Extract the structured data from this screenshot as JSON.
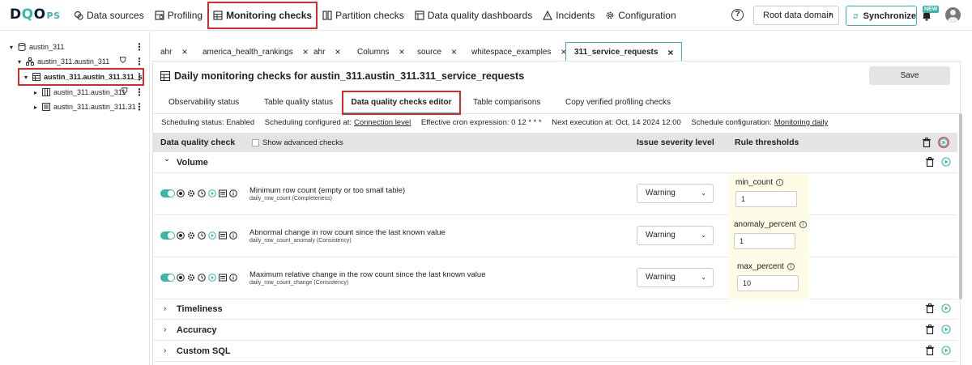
{
  "app": {
    "logo_main": "D",
    "logo_q": "Q",
    "logo_o": "O",
    "logo_ps": "PS"
  },
  "nav": [
    {
      "label": "Data sources",
      "icon": "data-sources-icon"
    },
    {
      "label": "Profiling",
      "icon": "profiling-icon"
    },
    {
      "label": "Monitoring checks",
      "icon": "monitoring-table-icon",
      "active": true
    },
    {
      "label": "Partition checks",
      "icon": "partition-icon"
    },
    {
      "label": "Data quality dashboards",
      "icon": "dashboards-icon"
    },
    {
      "label": "Incidents",
      "icon": "incidents-icon"
    },
    {
      "label": "Configuration",
      "icon": "gear-icon"
    }
  ],
  "header": {
    "help": "?",
    "root_domain": "Root data domain",
    "root_domain_chevron": "›",
    "sync": "Synchronize",
    "new_badge": "NEW"
  },
  "tree": [
    {
      "label": "austin_311",
      "toggle": "▾",
      "icon": "database-icon"
    },
    {
      "label": "austin_311.austin_311",
      "toggle": "▾",
      "icon": "schema-icon"
    },
    {
      "label": "austin_311.austin_311.311_s",
      "toggle": "▾",
      "icon": "table-icon",
      "selected": true
    },
    {
      "label": "austin_311.austin_311",
      "toggle": "▸",
      "icon": "columns-icon"
    },
    {
      "label": "austin_311.austin_311.31",
      "toggle": "▸",
      "icon": "checks-icon"
    }
  ],
  "editor_tabs": [
    {
      "label": "ahr",
      "close": "×"
    },
    {
      "label": "america_health_rankings",
      "close": "×"
    },
    {
      "label": "ahr",
      "close": "×"
    },
    {
      "label": "Columns",
      "close": "×"
    },
    {
      "label": "source",
      "close": "×"
    },
    {
      "label": "whitespace_examples",
      "close": "×"
    },
    {
      "label": "311_service_requests",
      "close": "×",
      "active": true
    }
  ],
  "page": {
    "title": "Daily monitoring checks for austin_311.austin_311.311_service_requests",
    "save": "Save"
  },
  "sub_tabs": [
    {
      "label": "Observability status"
    },
    {
      "label": "Table quality status"
    },
    {
      "label": "Data quality checks editor",
      "active": true
    },
    {
      "label": "Table comparisons"
    },
    {
      "label": "Copy verified profiling checks"
    }
  ],
  "schedule": {
    "status_label": "Scheduling status: Enabled",
    "configured_label": "Scheduling configured at:",
    "configured_link": "Connection level",
    "cron_label": "Effective cron expression: 0 12 * * *",
    "next_label": "Next execution at: Oct, 14 2024 12:00",
    "config_label": "Schedule configuration:",
    "config_link": "Monitoring daily"
  },
  "grid": {
    "col_check": "Data quality check",
    "advanced": "Show advanced checks",
    "col_severity": "Issue severity level",
    "col_thresholds": "Rule thresholds"
  },
  "categories": {
    "volume": {
      "name": "Volume",
      "chevron": "⌄"
    },
    "timeliness": {
      "name": "Timeliness",
      "chevron": "›"
    },
    "accuracy": {
      "name": "Accuracy",
      "chevron": "›"
    },
    "custom_sql": {
      "name": "Custom SQL",
      "chevron": "›"
    }
  },
  "checks": [
    {
      "name": "Minimum row count (empty or too small table)",
      "sub": "daily_row_count (Completeness)",
      "severity": "Warning",
      "threshold_label": "min_count",
      "threshold_value": "1"
    },
    {
      "name": "Abnormal change in row count since the last known value",
      "sub": "daily_row_count_anomaly (Consistency)",
      "severity": "Warning",
      "threshold_label": "anomaly_percent",
      "threshold_value": "1"
    },
    {
      "name": "Maximum relative change in the row count since the last known value",
      "sub": "daily_row_count_change (Consistency)",
      "severity": "Warning",
      "threshold_label": "max_percent",
      "threshold_value": "10"
    }
  ],
  "symbols": {
    "dropdown": "⌄",
    "info": "i",
    "dots": "⋮",
    "filter": "⛉"
  },
  "colors": {
    "accent": "#3ab5a8",
    "highlight": "#d82a2a",
    "threshold_bg": "#fefbe6",
    "grid_header": "#e4e4e4"
  }
}
